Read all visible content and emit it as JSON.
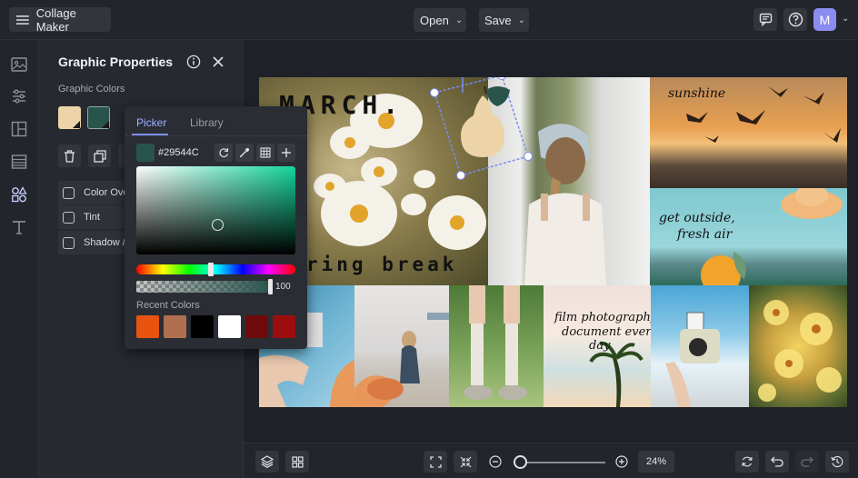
{
  "app": {
    "name": "Collage Maker",
    "open_label": "Open",
    "save_label": "Save",
    "avatar_initial": "M"
  },
  "panel": {
    "title": "Graphic Properties",
    "section_label": "Graphic Colors",
    "swatches": [
      "#ecd4a8",
      "#29544c"
    ],
    "options": [
      "Color Overlay",
      "Tint",
      "Shadow / Glow"
    ]
  },
  "picker": {
    "tabs": [
      "Picker",
      "Library"
    ],
    "active_tab": "Picker",
    "hex": "#29544C",
    "alpha": "100",
    "recent_label": "Recent Colors",
    "recent_colors": [
      "#e8530f",
      "#b07050",
      "#000000",
      "#ffffff",
      "#6e0a0a",
      "#9c0e0e"
    ]
  },
  "collage": {
    "text_march": "MARCH.",
    "text_spring": "ring break",
    "text_sunshine": "sunshine",
    "text_outside_1": "get outside,",
    "text_outside_2": "fresh air",
    "text_film_1": "film photography.",
    "text_film_2": "document every",
    "text_film_3": "day"
  },
  "zoom": {
    "value": "24%",
    "level": 0.06
  },
  "colors": {
    "accent": "#7a8cf0",
    "avatar": "#8b8cf0",
    "selected_graphic": "#29544c"
  }
}
